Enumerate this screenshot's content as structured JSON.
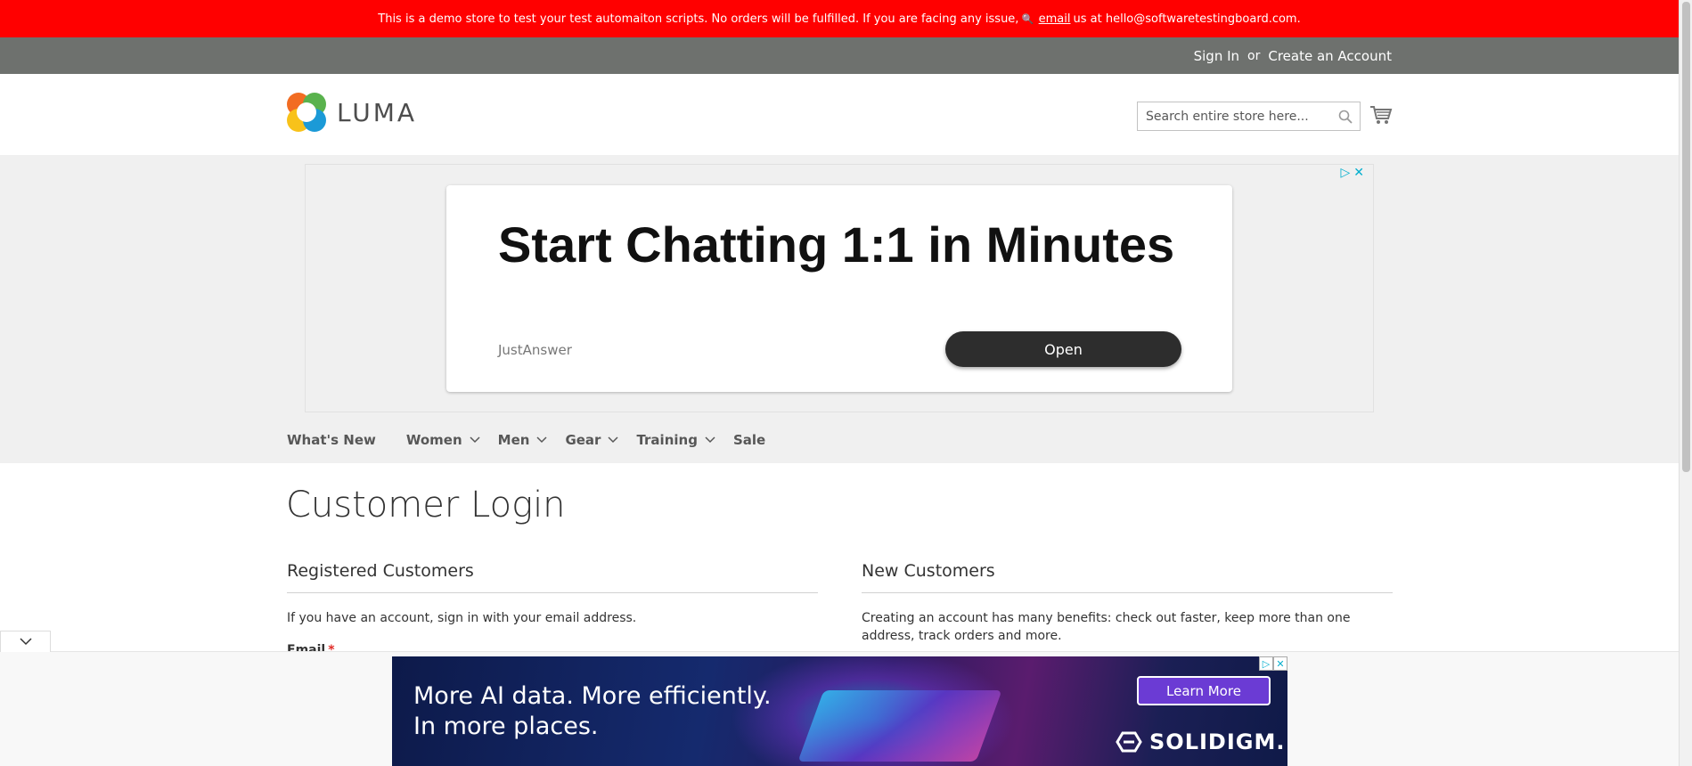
{
  "notice": {
    "text_before": "This is a demo store to test your test automaiton scripts. No orders will be fulfilled. If you are facing any issue,",
    "icon": "magnifier-icon",
    "email_link": "email",
    "text_after": "us at hello@softwaretestingboard.com."
  },
  "account": {
    "sign_in": "Sign In",
    "or": "or",
    "create_account": "Create an Account"
  },
  "header": {
    "logo_text": "LUMA",
    "search_placeholder": "Search entire store here...",
    "cart_icon": "cart-icon"
  },
  "ad": {
    "headline": "Start Chatting 1:1 in Minutes",
    "brand": "JustAnswer",
    "cta": "Open",
    "controls": [
      "▷",
      "✕"
    ]
  },
  "nav": {
    "items": [
      {
        "label": "What's New",
        "submenu": false
      },
      {
        "label": "Women",
        "submenu": true
      },
      {
        "label": "Men",
        "submenu": true
      },
      {
        "label": "Gear",
        "submenu": true
      },
      {
        "label": "Training",
        "submenu": true
      },
      {
        "label": "Sale",
        "submenu": false
      }
    ]
  },
  "main": {
    "title": "Customer Login",
    "registered": {
      "heading": "Registered Customers",
      "text": "If you have an account, sign in with your email address.",
      "email_label": "Email",
      "required_mark": "*"
    },
    "new_customers": {
      "heading": "New Customers",
      "text": "Creating an account has many benefits: check out faster, keep more than one address, track orders and more."
    }
  },
  "bottom_ad": {
    "line1": "More AI data. More efficiently.",
    "line2": "In more places.",
    "cta": "Learn More",
    "brand": "SOLIDIGM."
  },
  "colors": {
    "notice_bg": "#ff0000",
    "top_bar_bg": "#6e716e",
    "nav_bg": "#f0f0f0",
    "ad_link": "#00aecd",
    "required": "#e02b27"
  }
}
